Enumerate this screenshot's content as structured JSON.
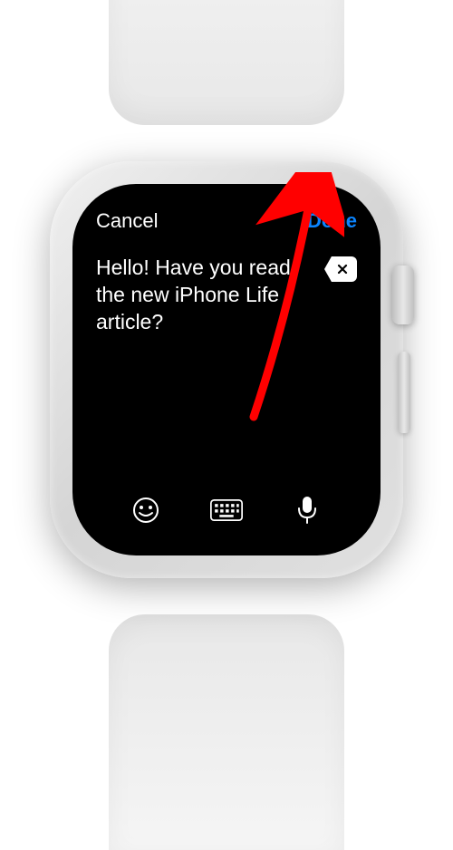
{
  "nav": {
    "cancel_label": "Cancel",
    "done_label": "Done"
  },
  "message": {
    "text": "Hello! Have you read the new iPhone Life article?"
  },
  "colors": {
    "accent": "#0a84ff",
    "background": "#000000",
    "text": "#ffffff"
  },
  "annotation": {
    "type": "arrow",
    "color": "#ff0000",
    "target": "done-button"
  }
}
